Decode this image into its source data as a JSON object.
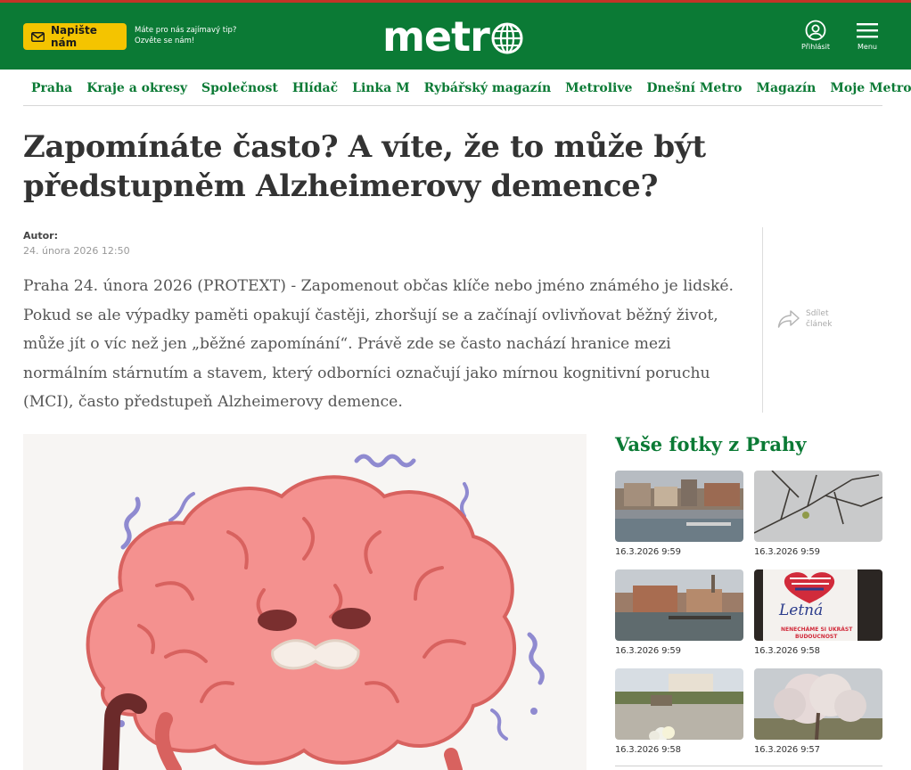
{
  "header": {
    "tip_button": "Napište nám",
    "tip_line1": "Máte pro nás zajímavý tip?",
    "tip_line2": "Ozvěte se nám!",
    "logo": "metr",
    "login_label": "Přihlásit",
    "menu_label": "Menu"
  },
  "nav": {
    "items": [
      "Praha",
      "Kraje a okresy",
      "Společnost",
      "Hlídač",
      "Linka M",
      "Rybářský magazín",
      "Metrolive",
      "Dnešní Metro",
      "Magazín",
      "Moje Metro"
    ]
  },
  "article": {
    "title": "Zapomínáte často? A víte, že to může být předstupněm Alzheimerovy demence?",
    "author_label": "Autor:",
    "date": "24. února 2026  12:50",
    "perex": "Praha 24. února 2026 (PROTEXT) - Zapomenout občas klíče nebo jméno známého je lidské. Pokud se ale výpadky paměti opakují častěji, zhoršují se a začínají ovlivňovat běžný život, může jít o víc než jen „běžné zapomínání“. Právě zde se často nachází hranice mezi normálním stárnutím a stavem, který odborníci označují jako mírnou kognitivní poruchu (MCI), často předstupeň Alzheimerovy demence.",
    "share_line1": "Sdílet",
    "share_line2": "článek"
  },
  "sidebar": {
    "title": "Vaše fotky z Prahy",
    "photos": [
      {
        "time": "16.3.2026 9:59"
      },
      {
        "time": "16.3.2026 9:59"
      },
      {
        "time": "16.3.2026 9:59"
      },
      {
        "time": "16.3.2026 9:58",
        "sign_text": "Letná",
        "sign_sub1": "NENECHÁME SI UKRÁST",
        "sign_sub2": "BUDOUCNOST"
      },
      {
        "time": "16.3.2026 9:58"
      },
      {
        "time": "16.3.2026 9:57"
      }
    ]
  },
  "colors": {
    "brand_green": "#0b7a35",
    "tip_yellow": "#f4c400",
    "text": "#333333"
  }
}
